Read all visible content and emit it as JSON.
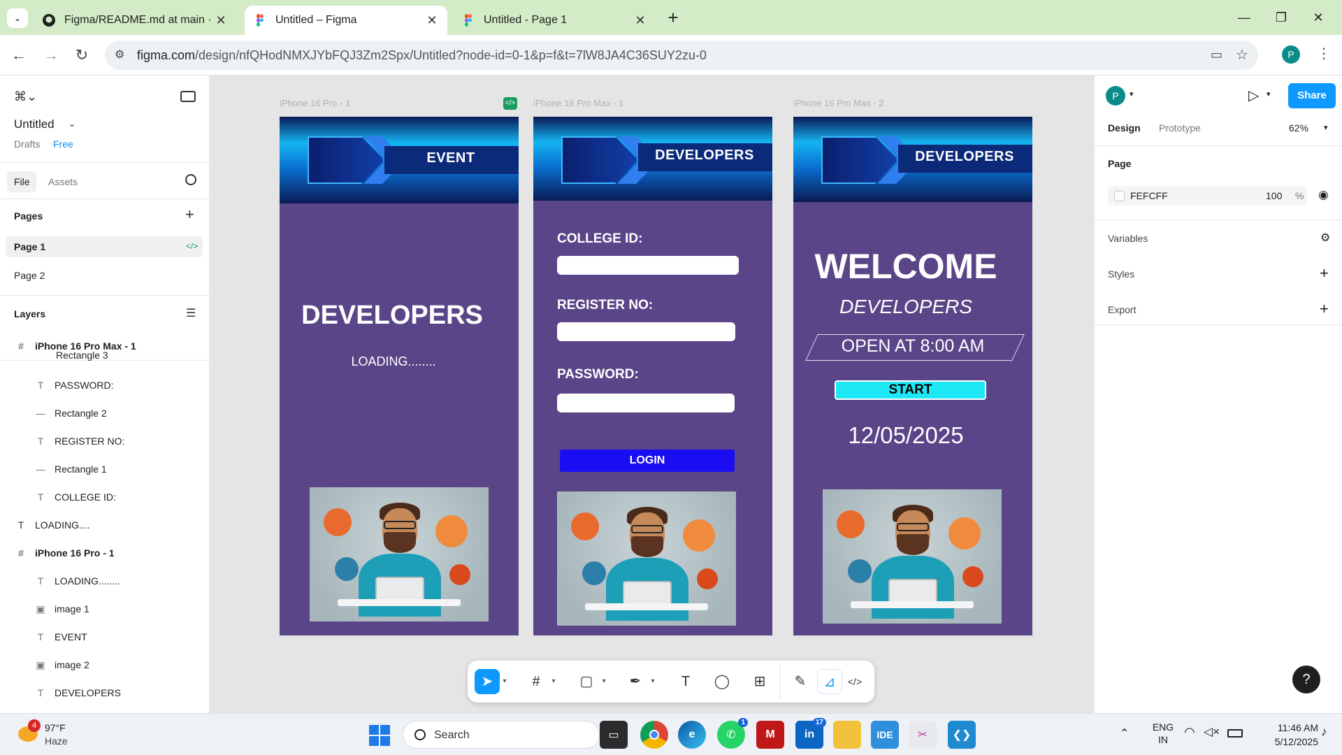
{
  "browser": {
    "tabs": [
      {
        "title": "Figma/README.md at main · Cl",
        "close": "✕"
      },
      {
        "title": "Untitled – Figma",
        "close": "✕"
      },
      {
        "title": "Untitled - Page 1",
        "close": "✕"
      }
    ],
    "new_tab": "+",
    "url_domain": "figma.com",
    "url_path": "/design/nfQHodNMXJYbFQJ3Zm2Spx/Untitled?node-id=0-1&p=f&t=7lW8JA4C36SUY2zu-0",
    "profile_initial": "P"
  },
  "left_panel": {
    "file_name": "Untitled",
    "drafts": "Drafts",
    "plan": "Free",
    "tabs": {
      "file": "File",
      "assets": "Assets"
    },
    "pages_heading": "Pages",
    "pages": [
      "Page 1",
      "Page 2"
    ],
    "layers_heading": "Layers",
    "layers": [
      {
        "name": "iPhone 16 Pro Max - 1",
        "type": "frame"
      },
      {
        "name": "Rectangle 3",
        "type": "rect"
      },
      {
        "name": "PASSWORD:",
        "type": "text"
      },
      {
        "name": "Rectangle 2",
        "type": "line"
      },
      {
        "name": "REGISTER NO:",
        "type": "text"
      },
      {
        "name": "Rectangle 1",
        "type": "line"
      },
      {
        "name": "COLLEGE ID:",
        "type": "text"
      },
      {
        "name": "LOADING....",
        "type": "text"
      },
      {
        "name": "iPhone 16 Pro - 1",
        "type": "frame"
      },
      {
        "name": "LOADING........",
        "type": "text"
      },
      {
        "name": "image 1",
        "type": "image"
      },
      {
        "name": "EVENT",
        "type": "text"
      },
      {
        "name": "image 2",
        "type": "image"
      },
      {
        "name": "DEVELOPERS",
        "type": "text"
      }
    ]
  },
  "canvas": {
    "frames": [
      {
        "label": "iPhone 16 Pro - 1",
        "banner": "EVENT",
        "title": "DEVELOPERS",
        "subtitle": "LOADING........"
      },
      {
        "label": "iPhone 16 Pro Max - 1",
        "banner": "DEVELOPERS",
        "college_label": "COLLEGE ID:",
        "register_label": "REGISTER NO:",
        "password_label": "PASSWORD:",
        "login_label": "LOGIN"
      },
      {
        "label": "iPhone 16 Pro Max - 2",
        "banner": "DEVELOPERS",
        "welcome": "WELCOME",
        "developers": "DEVELOPERS",
        "open_at": "OPEN AT 8:00 AM",
        "start_label": "START",
        "date": "12/05/2025"
      }
    ]
  },
  "right_panel": {
    "avatar": "P",
    "share": "Share",
    "tabs": {
      "design": "Design",
      "prototype": "Prototype"
    },
    "zoom": "62%",
    "page_heading": "Page",
    "page_color": "FEFCFF",
    "page_opacity": "100",
    "percent": "%",
    "variables": "Variables",
    "styles": "Styles",
    "export": "Export",
    "help": "?"
  },
  "taskbar": {
    "weather_temp": "97°F",
    "weather_desc": "Haze",
    "weather_badge": "4",
    "search": "Search",
    "lang1": "ENG",
    "lang2": "IN",
    "time": "11:46 AM",
    "date": "5/12/2025",
    "whatsapp_badge": "1",
    "linkedin_badge": "17",
    "ide_label": "IDE"
  },
  "colors": {
    "frame_bg": "#5a4588",
    "login_button": "#1a0df2",
    "start_button": "#1ee8f5",
    "share_button": "#0d99ff",
    "tab_bar": "#d3ecc7"
  }
}
